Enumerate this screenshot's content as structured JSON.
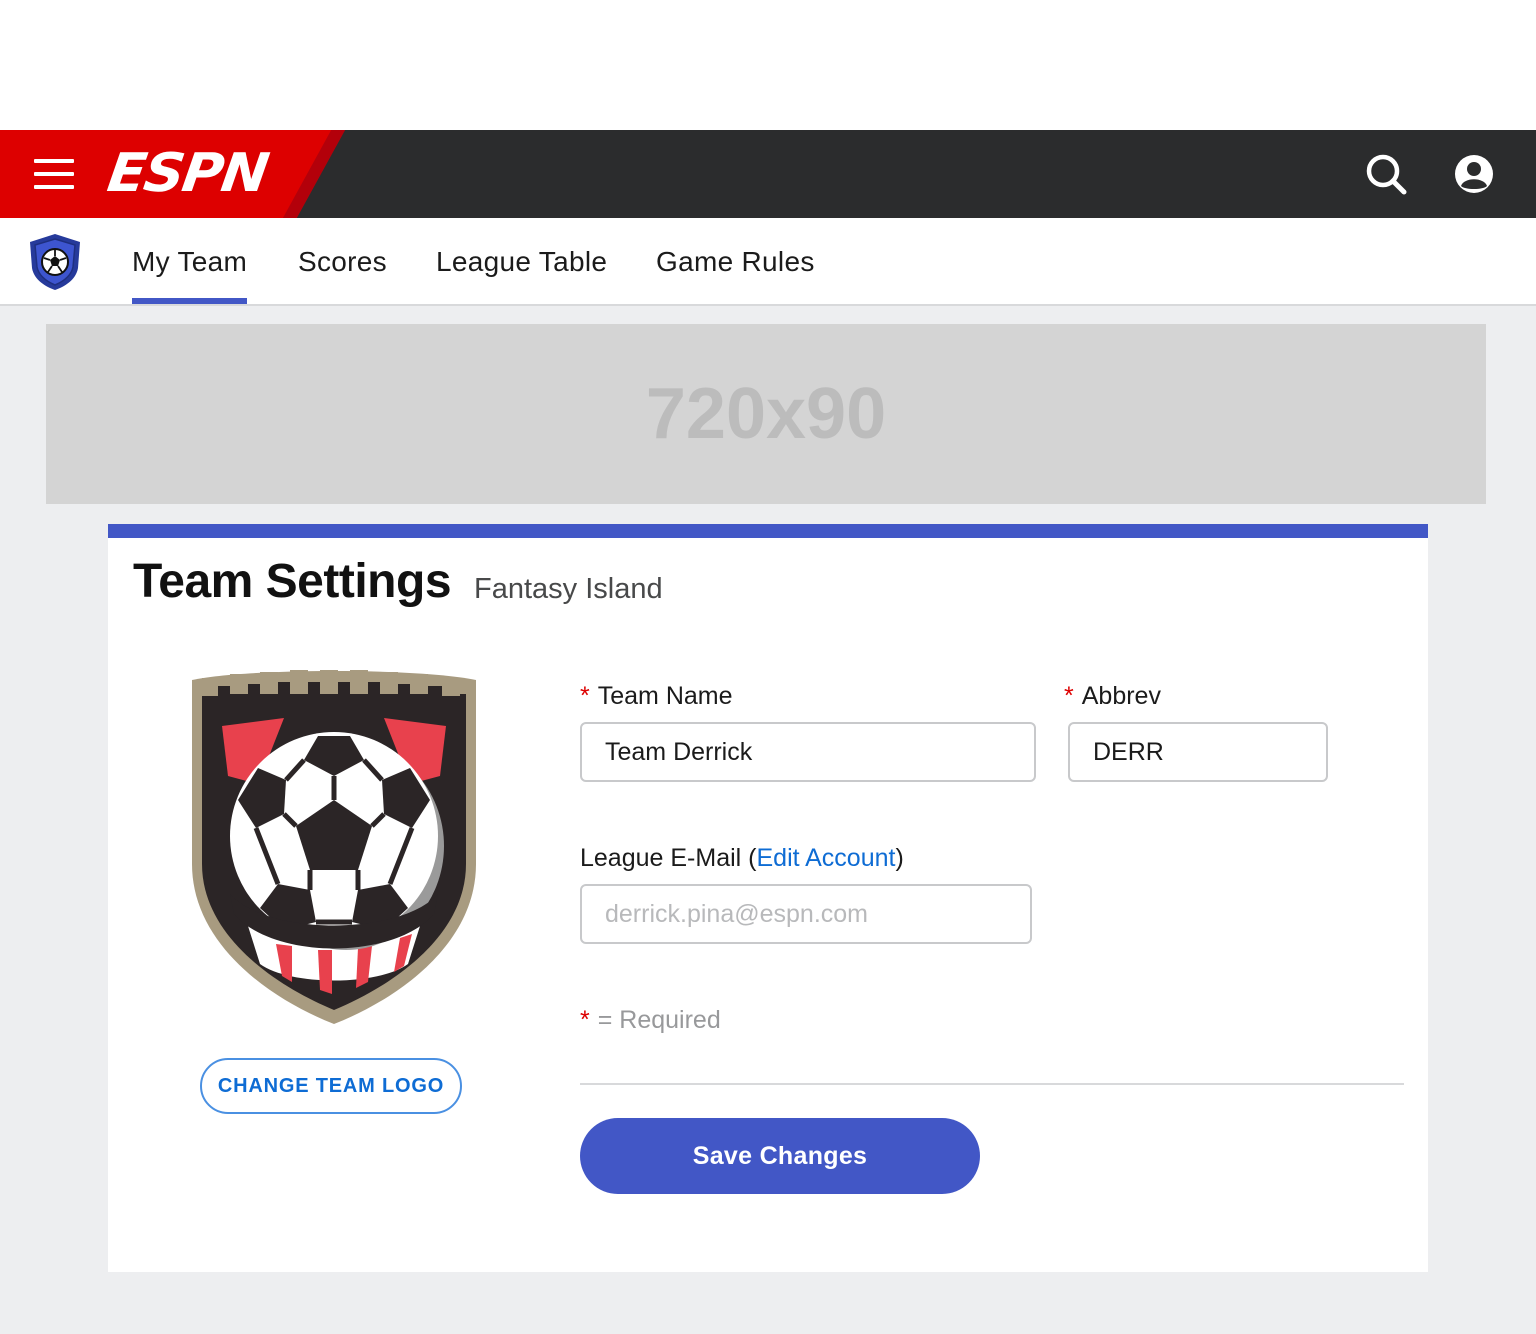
{
  "header": {
    "logo_text": "ESPN",
    "menu_icon": "hamburger-menu-icon",
    "search_icon": "search-icon",
    "profile_icon": "user-profile-icon",
    "brand_red": "#dd0000",
    "bar_color": "#2b2c2d"
  },
  "subnav": {
    "logo_icon": "soccer-shield-icon",
    "items": [
      {
        "label": "My Team",
        "active": true
      },
      {
        "label": "Scores",
        "active": false
      },
      {
        "label": "League Table",
        "active": false
      },
      {
        "label": "Game Rules",
        "active": false
      }
    ],
    "accent": "#4257c6"
  },
  "ad": {
    "text": "720x90"
  },
  "settings": {
    "title": "Team Settings",
    "subtitle": "Fantasy Island",
    "team_logo_icon": "team-crest-soccer-ball-icon",
    "change_logo_label": "CHANGE TEAM LOGO",
    "required_mark": "*",
    "team_name_label": "Team Name",
    "team_name_value": "Team Derrick",
    "abbrev_label": "Abbrev",
    "abbrev_value": "DERR",
    "email_label_prefix": "League E-Mail (",
    "email_link": "Edit Account",
    "email_label_suffix": ")",
    "email_placeholder": "derrick.pina@espn.com",
    "required_note": "= Required",
    "save_label": "Save Changes"
  }
}
